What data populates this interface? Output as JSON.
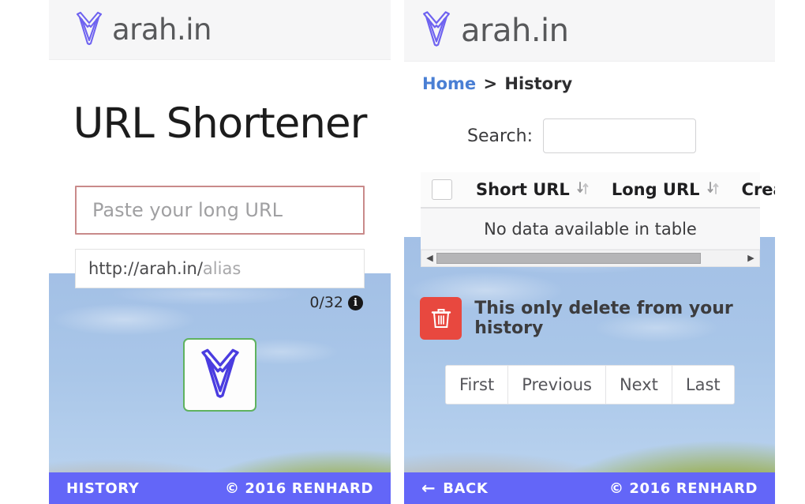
{
  "brand": {
    "name": "arah.in",
    "logo_icon": "arah-v-logo-icon",
    "logo_color": "#5b50e8"
  },
  "left_panel": {
    "headline": "URL Shortener",
    "long_url_input": {
      "placeholder": "Paste your long URL",
      "value": "",
      "border_color": "#c98a8a"
    },
    "alias_input": {
      "prefix": "http://arah.in/",
      "placeholder": "alias",
      "value": ""
    },
    "counter": {
      "text": "0/32",
      "info_icon": "info-circle-icon"
    },
    "submit_button": {
      "icon": "arah-v-logo-icon",
      "border_color": "#5fb25f"
    },
    "footer": {
      "link": "HISTORY",
      "copyright": "© 2016 RENHARD",
      "bar_color": "#6366f8"
    }
  },
  "right_panel": {
    "breadcrumb": {
      "home": "Home",
      "separator": ">",
      "current": "History",
      "link_color": "#4a7fd4"
    },
    "search": {
      "label": "Search:",
      "placeholder": "",
      "value": ""
    },
    "table": {
      "select_all_checkbox": false,
      "columns": [
        "Short URL",
        "Long URL",
        "Crea"
      ],
      "sort_icon": "sort-updown-icon",
      "empty_message": "No data available in table",
      "scrollbar": {
        "left_arrow": "◀",
        "right_arrow": "▶",
        "thumb_percent": 86
      }
    },
    "delete": {
      "icon": "trash-icon",
      "button_color": "#e8483f",
      "note": "This only delete from your history"
    },
    "pagination": {
      "buttons": [
        "First",
        "Previous",
        "Next",
        "Last"
      ]
    },
    "footer": {
      "back_icon": "arrow-left-icon",
      "link": "BACK",
      "copyright": "© 2016 RENHARD",
      "bar_color": "#6366f8"
    }
  }
}
